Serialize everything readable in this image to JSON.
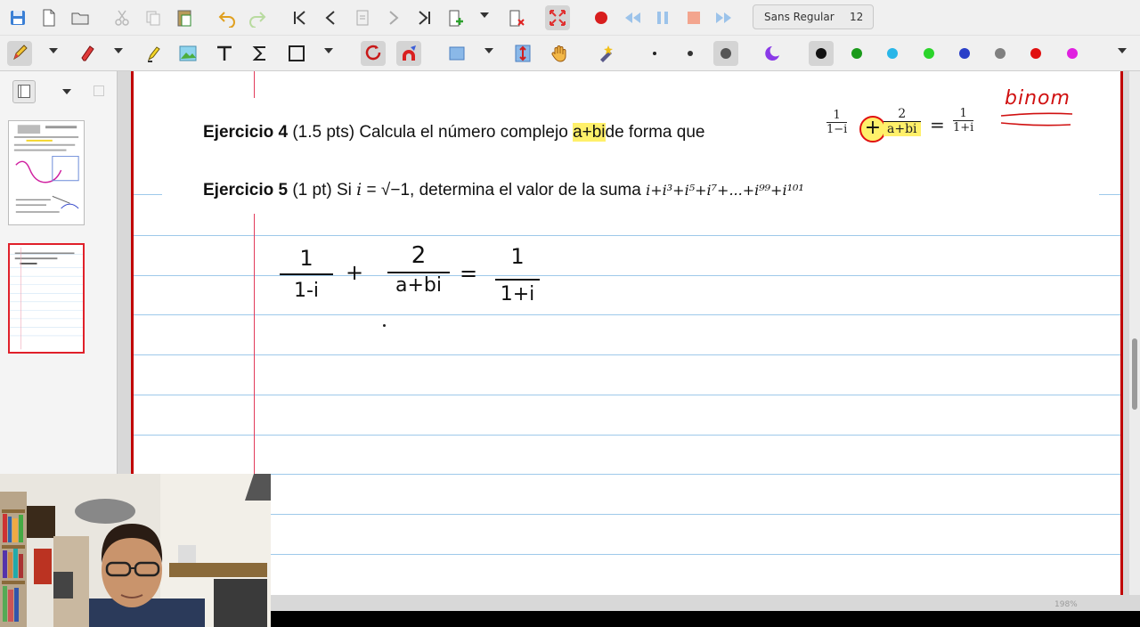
{
  "toolbar": {
    "font_name": "Sans Regular",
    "font_size": "12"
  },
  "document": {
    "ex4": {
      "title": "Ejercicio 4",
      "points": "(1.5 pts)",
      "text_before": "Calcula el número complejo",
      "highlight": "a+bi",
      "text_after": "de forma que",
      "frac1_num": "1",
      "frac1_den": "1−i",
      "plus": "+",
      "frac2_num": "2",
      "frac2_den": "a+bi",
      "equals": "=",
      "frac3_num": "1",
      "frac3_den": "1+i"
    },
    "ex5": {
      "title": "Ejercicio 5",
      "points": "(1 pt)",
      "text_si": "Si",
      "i_sym": "i",
      "eq": "=",
      "sqrt": "√−1,",
      "text_after": "determina el valor de la suma",
      "sum": "i+i³+i⁵+i⁷+...+i⁹⁹+i¹⁰¹"
    },
    "annotation": "binom",
    "handwritten": {
      "f1_num": "1",
      "f1_den": "1-i",
      "plus": "+",
      "f2_num": "2",
      "f2_den": "a+bi",
      "equals": "=",
      "f3_num": "1",
      "f3_den": "1+i"
    }
  },
  "status": {
    "zoom": "198%"
  },
  "colors": {
    "accent_red": "#e0202a",
    "highlight": "#fff06a",
    "rule": "#9ec9ea",
    "margin": "#e23b5a",
    "palette": [
      "#111111",
      "#1a9a1a",
      "#29b6e8",
      "#2bd42b",
      "#2a3fc8",
      "#808080",
      "#e01010",
      "#e020e0"
    ]
  }
}
